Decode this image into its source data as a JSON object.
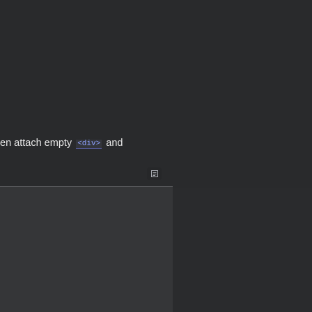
{
  "message": {
    "text_before": "en attach empty",
    "code": "<div>",
    "text_after": "and"
  },
  "icons": {
    "copy": "copy-icon"
  },
  "colors": {
    "background": "#2a2b2d",
    "panel": "#353638",
    "text": "#e9e9e9",
    "code_text": "#8fa2ff"
  }
}
